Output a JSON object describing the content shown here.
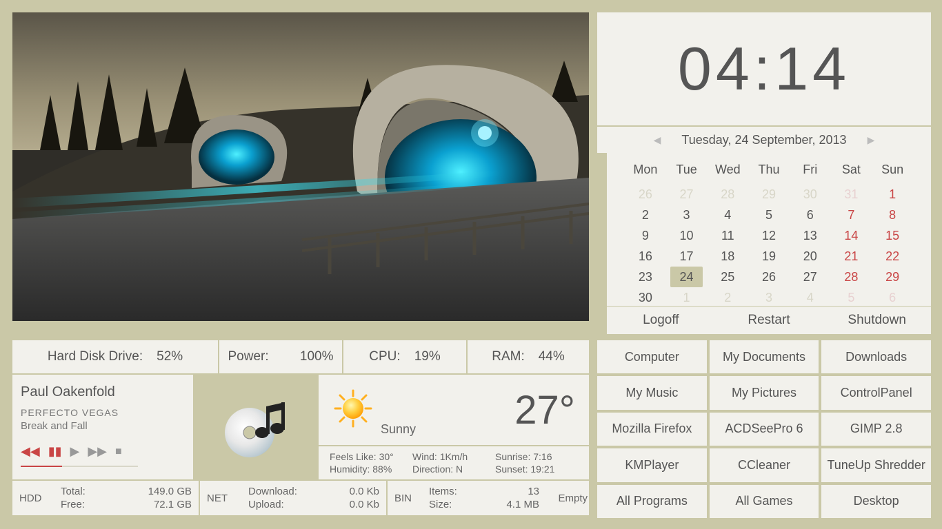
{
  "clock": {
    "time": "04:14",
    "date": "Tuesday, 24 September, 2013"
  },
  "calendar": {
    "headers": [
      "Mon",
      "Tue",
      "Wed",
      "Thu",
      "Fri",
      "Sat",
      "Sun"
    ],
    "rows": [
      [
        {
          "d": "26",
          "o": 1
        },
        {
          "d": "27",
          "o": 1
        },
        {
          "d": "28",
          "o": 1
        },
        {
          "d": "29",
          "o": 1
        },
        {
          "d": "30",
          "o": 1
        },
        {
          "d": "31",
          "o": 1,
          "w": 1
        },
        {
          "d": "1",
          "w": 1
        }
      ],
      [
        {
          "d": "2"
        },
        {
          "d": "3"
        },
        {
          "d": "4"
        },
        {
          "d": "5"
        },
        {
          "d": "6"
        },
        {
          "d": "7",
          "w": 1
        },
        {
          "d": "8",
          "w": 1
        }
      ],
      [
        {
          "d": "9"
        },
        {
          "d": "10"
        },
        {
          "d": "11"
        },
        {
          "d": "12"
        },
        {
          "d": "13"
        },
        {
          "d": "14",
          "w": 1
        },
        {
          "d": "15",
          "w": 1
        }
      ],
      [
        {
          "d": "16"
        },
        {
          "d": "17"
        },
        {
          "d": "18"
        },
        {
          "d": "19"
        },
        {
          "d": "20"
        },
        {
          "d": "21",
          "w": 1
        },
        {
          "d": "22",
          "w": 1
        }
      ],
      [
        {
          "d": "23"
        },
        {
          "d": "24",
          "t": 1
        },
        {
          "d": "25"
        },
        {
          "d": "26"
        },
        {
          "d": "27"
        },
        {
          "d": "28",
          "w": 1
        },
        {
          "d": "29",
          "w": 1
        }
      ],
      [
        {
          "d": "30"
        },
        {
          "d": "1",
          "o": 1
        },
        {
          "d": "2",
          "o": 1
        },
        {
          "d": "3",
          "o": 1
        },
        {
          "d": "4",
          "o": 1
        },
        {
          "d": "5",
          "o": 1,
          "w": 1
        },
        {
          "d": "6",
          "o": 1,
          "w": 1
        }
      ]
    ]
  },
  "power": {
    "logoff": "Logoff",
    "restart": "Restart",
    "shutdown": "Shutdown"
  },
  "launchers": [
    "Computer",
    "My Documents",
    "Downloads",
    "My Music",
    "My Pictures",
    "ControlPanel",
    "Mozilla Firefox",
    "ACDSeePro 6",
    "GIMP 2.8",
    "KMPlayer",
    "CCleaner",
    "TuneUp Shredder",
    "All Programs",
    "All Games",
    "Desktop"
  ],
  "sys": {
    "hdd_l": "Hard Disk Drive:",
    "hdd_v": "52%",
    "pwr_l": "Power:",
    "pwr_v": "100%",
    "cpu_l": "CPU:",
    "cpu_v": "19%",
    "ram_l": "RAM:",
    "ram_v": "44%"
  },
  "media": {
    "artist": "Paul Oakenfold",
    "album": "PERFECTO VEGAS",
    "track": "Break and Fall"
  },
  "weather": {
    "cond": "Sunny",
    "temp": "27°",
    "feels_l": "Feels Like:",
    "feels_v": "30°",
    "hum_l": "Humidity:",
    "hum_v": "88%",
    "wind_l": "Wind:",
    "wind_v": "1Km/h",
    "dir_l": "Direction:",
    "dir_v": "N",
    "rise_l": "Sunrise:",
    "rise_v": "7:16",
    "set_l": "Sunset:",
    "set_v": "19:21"
  },
  "hdd": {
    "title": "HDD",
    "total_l": "Total:",
    "total_v": "149.0 GB",
    "free_l": "Free:",
    "free_v": "72.1 GB"
  },
  "net": {
    "title": "NET",
    "dl_l": "Download:",
    "dl_v": "0.0 Kb",
    "ul_l": "Upload:",
    "ul_v": "0.0 Kb"
  },
  "bin": {
    "title": "BIN",
    "items_l": "Items:",
    "items_v": "13",
    "size_l": "Size:",
    "size_v": "4.1 MB",
    "empty": "Empty"
  }
}
